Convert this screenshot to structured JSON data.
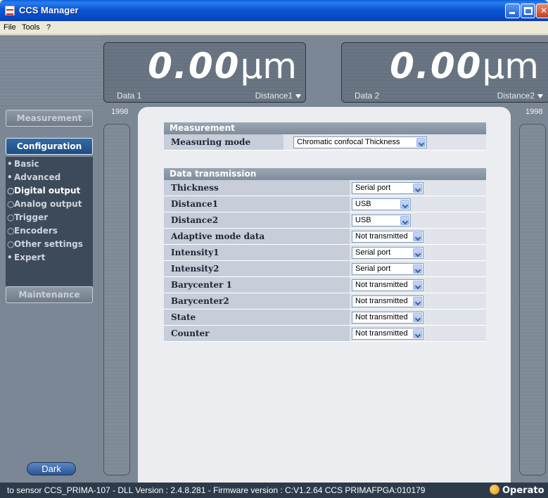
{
  "window": {
    "title": "CCS Manager"
  },
  "menu": [
    "File",
    "Tools",
    "?"
  ],
  "displays": [
    {
      "value": "0.00",
      "unit": "µm",
      "label": "Data 1",
      "source": "Distance1"
    },
    {
      "value": "0.00",
      "unit": "µm",
      "label": "Data 2",
      "source": "Distance2"
    }
  ],
  "counts": {
    "left": "1998",
    "right": "1998"
  },
  "nav": {
    "measurement": "Measurement",
    "configuration": "Configuration",
    "maintenance": "Maintenance",
    "items": [
      {
        "bullet": "•",
        "label": "Basic"
      },
      {
        "bullet": "•",
        "label": "Advanced"
      },
      {
        "bullet": "○",
        "label": "Digital output"
      },
      {
        "bullet": "○",
        "label": "Analog output"
      },
      {
        "bullet": "○",
        "label": "Trigger"
      },
      {
        "bullet": "○",
        "label": "Encoders"
      },
      {
        "bullet": "○",
        "label": "Other settings"
      },
      {
        "bullet": "•",
        "label": "Expert"
      }
    ],
    "dark_button": "Dark"
  },
  "measurement_section": {
    "header": "Measurement",
    "label": "Measuring mode",
    "value": "Chromatic confocal Thickness"
  },
  "transmission_section": {
    "header": "Data transmission",
    "rows": [
      {
        "label": "Thickness",
        "value": "Serial port"
      },
      {
        "label": "Distance1",
        "value": "USB"
      },
      {
        "label": "Distance2",
        "value": "USB"
      },
      {
        "label": "Adaptive mode data",
        "value": "Not transmitted"
      },
      {
        "label": "Intensity1",
        "value": "Serial port"
      },
      {
        "label": "Intensity2",
        "value": "Serial port"
      },
      {
        "label": "Barycenter 1",
        "value": "Not transmitted"
      },
      {
        "label": "Barycenter2",
        "value": "Not transmitted"
      },
      {
        "label": "State",
        "value": "Not transmitted"
      },
      {
        "label": "Counter",
        "value": "Not transmitted"
      }
    ]
  },
  "status": {
    "text": "to sensor CCS_PRIMA-107 - DLL Version : 2.4.8.281 - Firmware version : C:V1.2.64 CCS PRIMAFPGA:010179",
    "user": "Operato"
  }
}
